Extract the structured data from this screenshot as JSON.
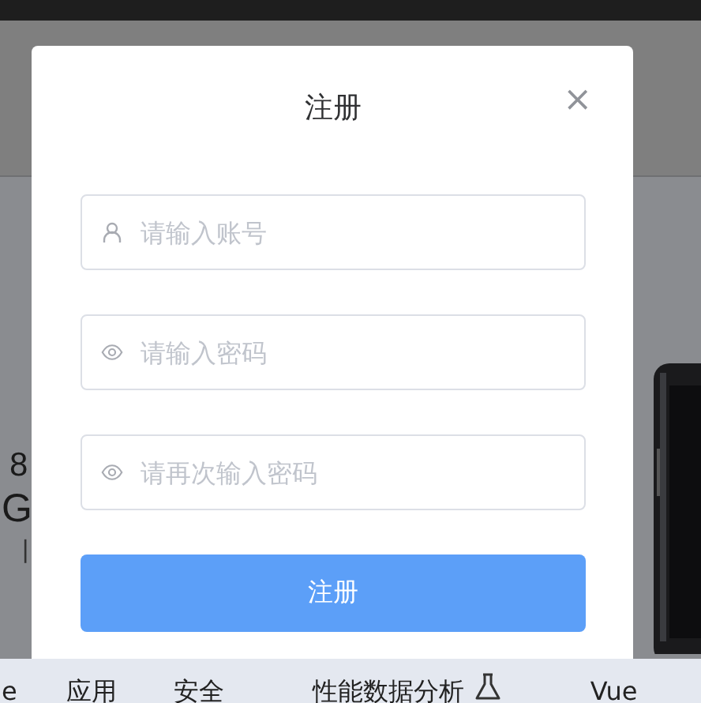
{
  "background": {
    "fragments": [
      "8",
      "G",
      "|"
    ],
    "nav": [
      {
        "kind": "text",
        "label": "e"
      },
      {
        "kind": "text",
        "label": "应用"
      },
      {
        "kind": "text",
        "label": "安全"
      },
      {
        "kind": "flask",
        "label": "性能数据分析"
      },
      {
        "kind": "text",
        "label": "Vue"
      }
    ]
  },
  "dialog": {
    "title": "注册",
    "close": "×",
    "fields": [
      {
        "kind": "text",
        "placeholder": "请输入账号"
      },
      {
        "kind": "password",
        "placeholder": "请输入密码"
      },
      {
        "kind": "password",
        "placeholder": "请再次输入密码"
      }
    ],
    "submit": "注册"
  }
}
